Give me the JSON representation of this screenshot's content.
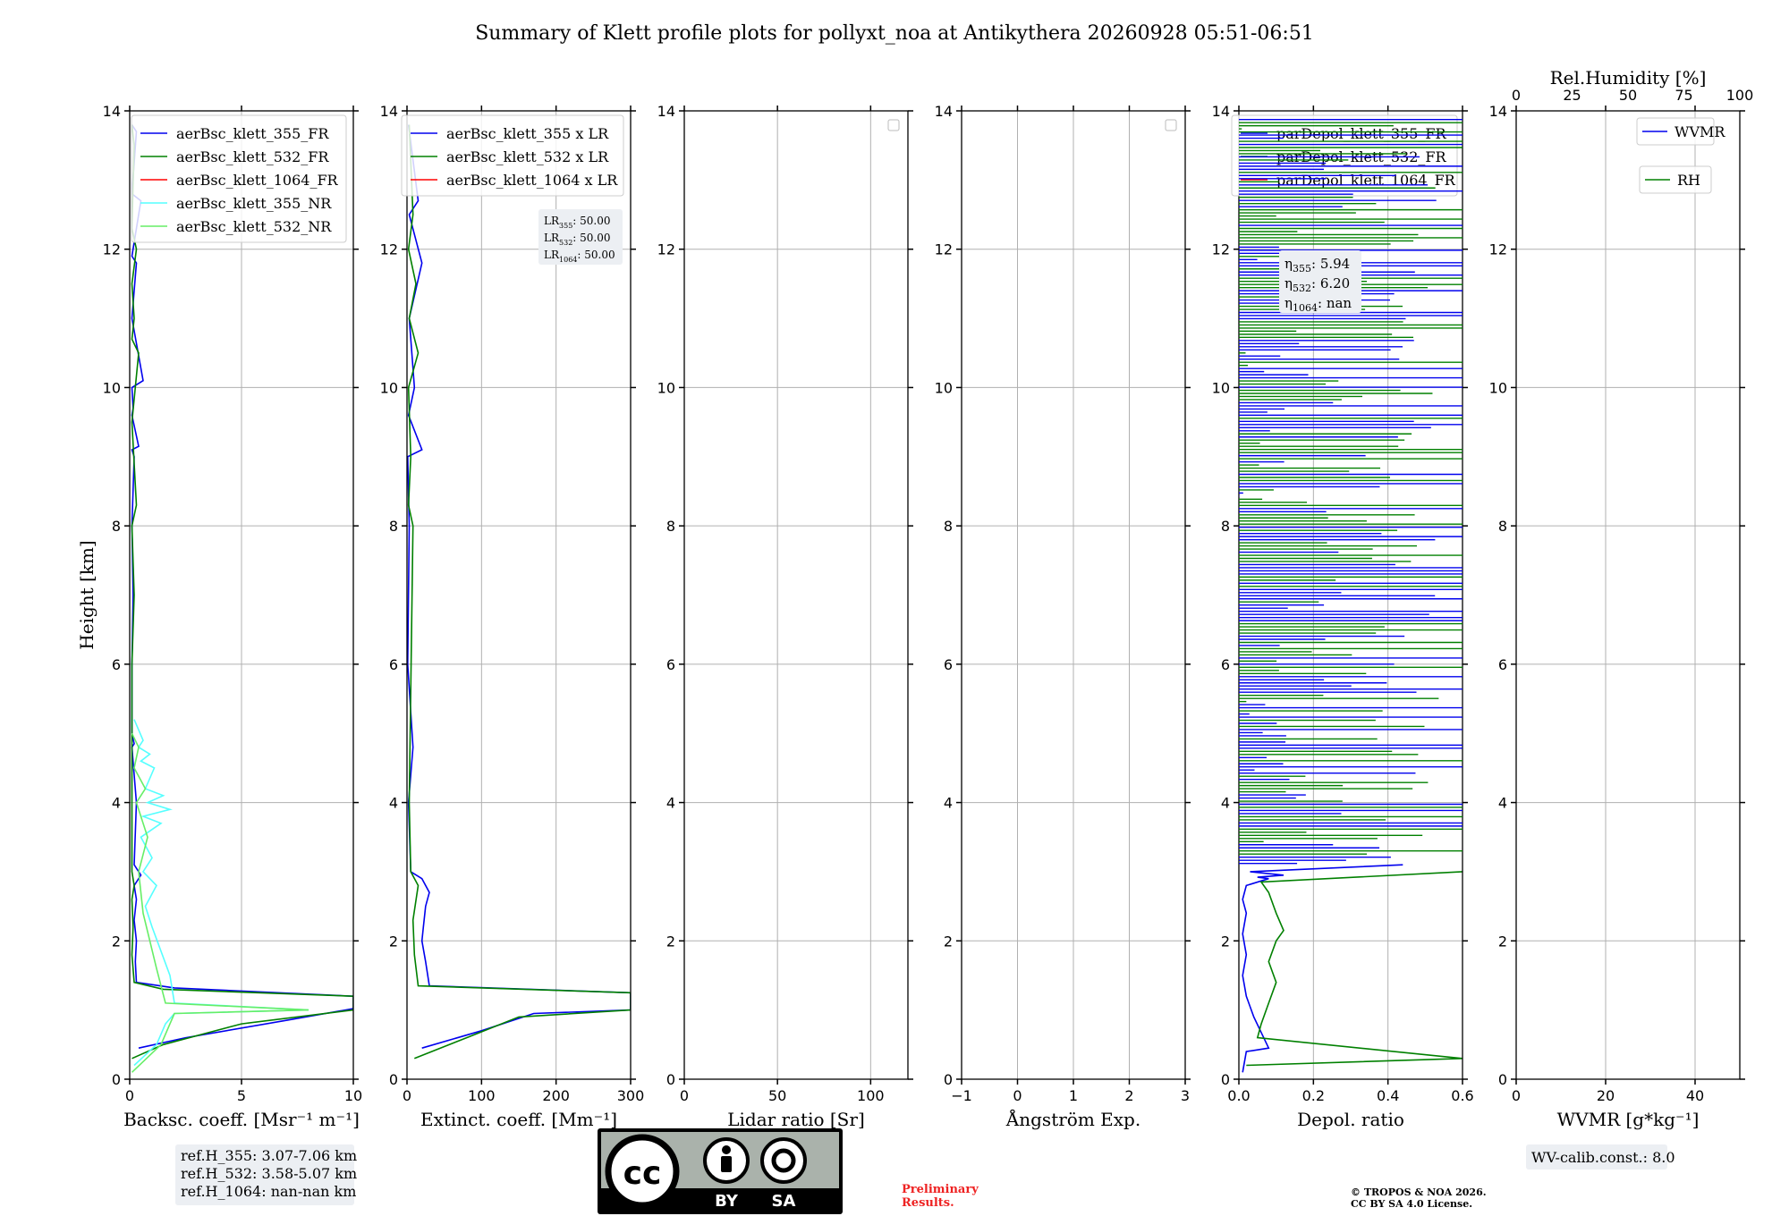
{
  "figure": {
    "title": "Summary of Klett profile plots for pollyxt_noa at Antikythera 20260928 05:51-06:51",
    "refh_box": [
      "ref.H_355: 3.07-7.06 km",
      "ref.H_532: 3.58-5.07 km",
      "ref.H_1064: nan-nan km"
    ],
    "lr_box": [
      {
        "base": "LR",
        "sub": "355",
        "value": ": 50.00"
      },
      {
        "base": "LR",
        "sub": "532",
        "value": ": 50.00"
      },
      {
        "base": "LR",
        "sub": "1064",
        "value": ": 50.00"
      }
    ],
    "eta_box": [
      {
        "base": "η",
        "sub": "355",
        "value": ": 5.94"
      },
      {
        "base": "η",
        "sub": "532",
        "value": ": 6.20"
      },
      {
        "base": "η",
        "sub": "1064",
        "value": ": nan"
      }
    ],
    "wv_calib": "WV-calib.const.: 8.0",
    "license_badge": {
      "cc": "cc",
      "by": "BY",
      "sa": "SA"
    },
    "preliminary": [
      "Preliminary",
      "Results."
    ],
    "copyright": [
      "© TROPOS & NOA 2026.",
      "CC BY SA 4.0 License."
    ],
    "colors": {
      "blue": "#0000ee",
      "green": "#008000",
      "red": "#ff0000",
      "cyan": "#55ffff",
      "lightgreen": "#66ee66"
    }
  },
  "chart_data": [
    {
      "type": "line",
      "xlabel": "Backsc. coeff. [Msr⁻¹ m⁻¹]",
      "ylabel": "Height [km]",
      "xlim": [
        0,
        10
      ],
      "ylim": [
        0,
        14
      ],
      "xticks": [
        "0",
        "5",
        "10"
      ],
      "yticks": [
        "0",
        "2",
        "4",
        "6",
        "8",
        "10",
        "12",
        "14"
      ],
      "grid": true,
      "legend": "top-right",
      "series": [
        {
          "name": "aerBsc_klett_355_FR",
          "color": "#0000ee",
          "x": [
            0.4,
            2.5,
            7,
            10,
            10,
            2.0,
            0.3,
            0.25,
            0.3,
            0.2,
            0.3,
            0.2,
            0.5,
            0.2,
            0.3,
            0.1,
            0.2,
            0.1,
            0.1,
            0.15,
            0.1,
            0.2,
            0.1,
            0.4,
            0.1,
            0.15,
            0.1,
            0.6,
            0.1,
            0.3,
            0.1,
            0.5,
            0.1,
            0.3,
            0.1
          ],
          "y": [
            0.45,
            0.6,
            0.85,
            1.02,
            1.2,
            1.32,
            1.4,
            1.7,
            2.0,
            2.3,
            2.6,
            2.8,
            2.95,
            3.1,
            4.0,
            4.8,
            4.85,
            5.0,
            6.0,
            7.0,
            8.0,
            9.0,
            9.1,
            9.15,
            9.6,
            9.7,
            10.0,
            10.1,
            11.0,
            11.8,
            11.9,
            12.7,
            12.8,
            13.7,
            13.8
          ]
        },
        {
          "name": "aerBsc_klett_532_FR",
          "color": "#008000",
          "x": [
            0.1,
            1.5,
            5,
            10,
            10,
            1.5,
            0.2,
            0.1,
            0.15,
            0.1,
            0.2,
            0.1,
            0.1,
            0.1,
            0.1,
            0.2,
            0.1,
            0.3,
            0.1,
            0.4,
            0.1,
            0.2,
            0.1,
            0.3,
            0.1,
            0.2,
            0.1
          ],
          "y": [
            0.3,
            0.5,
            0.8,
            1.0,
            1.2,
            1.3,
            1.4,
            1.8,
            2.2,
            2.6,
            2.8,
            3.0,
            4.0,
            5.0,
            6.0,
            7.0,
            8.0,
            8.3,
            9.5,
            10.5,
            10.7,
            11.0,
            11.5,
            12.0,
            12.3,
            13.5,
            13.8
          ]
        },
        {
          "name": "aerBsc_klett_1064_FR",
          "color": "#ff0000",
          "x": [],
          "y": []
        },
        {
          "name": "aerBsc_klett_355_NR",
          "color": "#55ffff",
          "x": [
            0.2,
            1.2,
            1.6,
            2.0,
            8,
            2.0,
            1.8,
            1.0,
            0.7,
            1.2,
            0.6,
            1.0,
            0.5,
            1.4,
            0.6,
            1.8,
            0.8,
            1.5,
            0.7,
            1.1,
            0.5,
            0.9,
            0.4,
            0.6,
            0.2
          ],
          "y": [
            0.2,
            0.5,
            0.8,
            0.95,
            1.0,
            1.1,
            1.5,
            2.2,
            2.5,
            2.8,
            3.0,
            3.2,
            3.5,
            3.7,
            3.8,
            3.9,
            4.0,
            4.1,
            4.2,
            4.5,
            4.6,
            4.7,
            4.8,
            4.9,
            5.2
          ]
        },
        {
          "name": "aerBsc_klett_532_NR",
          "color": "#66ee66",
          "x": [
            0.1,
            1.4,
            1.8,
            2.0,
            8,
            1.6,
            1.2,
            0.6,
            0.4,
            0.8,
            0.3,
            0.7,
            0.2,
            0.4,
            0.1
          ],
          "y": [
            0.1,
            0.5,
            0.8,
            0.95,
            1.0,
            1.1,
            1.6,
            2.4,
            3.0,
            3.5,
            4.0,
            4.2,
            4.5,
            4.8,
            5.0
          ]
        }
      ],
      "annotation_box": "refh_box"
    },
    {
      "type": "line",
      "xlabel": "Extinct. coeff. [Mm⁻¹]",
      "xlim": [
        0,
        300
      ],
      "ylim": [
        0,
        14
      ],
      "xticks": [
        "0",
        "100",
        "200",
        "300"
      ],
      "yticks": [
        "0",
        "2",
        "4",
        "6",
        "8",
        "10",
        "12",
        "14"
      ],
      "grid": true,
      "legend": "top-right",
      "series": [
        {
          "name": "aerBsc_klett_355 x LR",
          "color": "#0000ee",
          "x": [
            20,
            100,
            170,
            300,
            300,
            30,
            25,
            20,
            22,
            25,
            30,
            20,
            5,
            2,
            8,
            1,
            3,
            1,
            20,
            2,
            10,
            3,
            20,
            3,
            15,
            2
          ],
          "y": [
            0.45,
            0.7,
            0.95,
            1.0,
            1.25,
            1.35,
            1.7,
            2.0,
            2.2,
            2.5,
            2.7,
            2.9,
            3.0,
            4.0,
            4.8,
            6.0,
            8.0,
            9.0,
            9.1,
            9.6,
            10.0,
            11.0,
            11.8,
            12.5,
            12.7,
            13.8
          ]
        },
        {
          "name": "aerBsc_klett_532 x LR",
          "color": "#008000",
          "x": [
            10,
            80,
            150,
            300,
            300,
            15,
            10,
            8,
            15,
            5,
            3,
            8,
            2,
            5,
            2,
            15,
            3,
            12,
            2,
            8,
            3
          ],
          "y": [
            0.3,
            0.6,
            0.9,
            1.0,
            1.25,
            1.35,
            1.8,
            2.3,
            2.8,
            3.0,
            4.0,
            8.0,
            8.3,
            9.0,
            10.0,
            10.5,
            11.0,
            11.5,
            12.0,
            12.5,
            13.8
          ]
        },
        {
          "name": "aerBsc_klett_1064 x LR",
          "color": "#ff0000",
          "x": [],
          "y": []
        }
      ],
      "annotation_box": "lr_box"
    },
    {
      "type": "line",
      "xlabel": "Lidar ratio [Sr]",
      "xlim": [
        0,
        120
      ],
      "ylim": [
        0,
        14
      ],
      "xticks": [
        "0",
        "50",
        "100"
      ],
      "yticks": [
        "0",
        "2",
        "4",
        "6",
        "8",
        "10",
        "12",
        "14"
      ],
      "grid": true,
      "legend": "top-right",
      "series": []
    },
    {
      "type": "line",
      "xlabel": "Ångström Exp.",
      "xlim": [
        -1,
        3
      ],
      "ylim": [
        0,
        14
      ],
      "xticks": [
        "−1",
        "0",
        "1",
        "2",
        "3"
      ],
      "yticks": [
        "0",
        "2",
        "4",
        "6",
        "8",
        "10",
        "12",
        "14"
      ],
      "grid": true,
      "legend": "top-right",
      "series": []
    },
    {
      "type": "line",
      "xlabel": "Depol. ratio",
      "xlim": [
        0,
        0.6
      ],
      "ylim": [
        0,
        14
      ],
      "xticks": [
        "0.0",
        "0.2",
        "0.4",
        "0.6"
      ],
      "yticks": [
        "0",
        "2",
        "4",
        "6",
        "8",
        "10",
        "12",
        "14"
      ],
      "grid": true,
      "legend": "top-right",
      "series": [
        {
          "name": "parDepol_klett_355_FR",
          "color": "#0000ee",
          "x": [
            0.01,
            0.02,
            0.08,
            0.04,
            0.02,
            0.01,
            0.02,
            0.01,
            0.02,
            0.01,
            0.02,
            0.08,
            0.05,
            0.12,
            0.03,
            0.44
          ],
          "y": [
            0.1,
            0.4,
            0.45,
            0.9,
            1.2,
            1.5,
            1.8,
            2.1,
            2.4,
            2.6,
            2.8,
            2.9,
            2.92,
            2.95,
            3.0,
            3.1
          ]
        },
        {
          "name": "parDepol_klett_532_FR",
          "color": "#008000",
          "x": [
            0.02,
            0.6,
            0.05,
            0.06,
            0.08,
            0.1,
            0.08,
            0.1,
            0.12,
            0.1,
            0.08,
            0.06,
            0.6
          ],
          "y": [
            0.2,
            0.3,
            0.6,
            0.8,
            1.1,
            1.4,
            1.7,
            2.0,
            2.15,
            2.4,
            2.7,
            2.85,
            3.0
          ]
        },
        {
          "name": "parDepol_klett_1064_FR",
          "color": "#ff0000",
          "x": [],
          "y": []
        }
      ],
      "annotation_box": "eta_box"
    },
    {
      "type": "line",
      "xlabel": "WVMR [g*kg⁻¹]",
      "x2label": "Rel.Humidity [%]",
      "xlim": [
        0,
        50
      ],
      "x2lim": [
        0,
        100
      ],
      "ylim": [
        0,
        14
      ],
      "xticks": [
        "0",
        "20",
        "40"
      ],
      "x2ticks": [
        "0",
        "25",
        "50",
        "75",
        "100"
      ],
      "yticks": [
        "0",
        "2",
        "4",
        "6",
        "8",
        "10",
        "12",
        "14"
      ],
      "grid": true,
      "legend": "top-right",
      "series": [
        {
          "name": "WVMR",
          "color": "#0000ee",
          "x": [],
          "y": []
        },
        {
          "name": "RH",
          "color": "#008000",
          "x": [],
          "y": []
        }
      ],
      "annotation_box": "wv_calib"
    }
  ]
}
